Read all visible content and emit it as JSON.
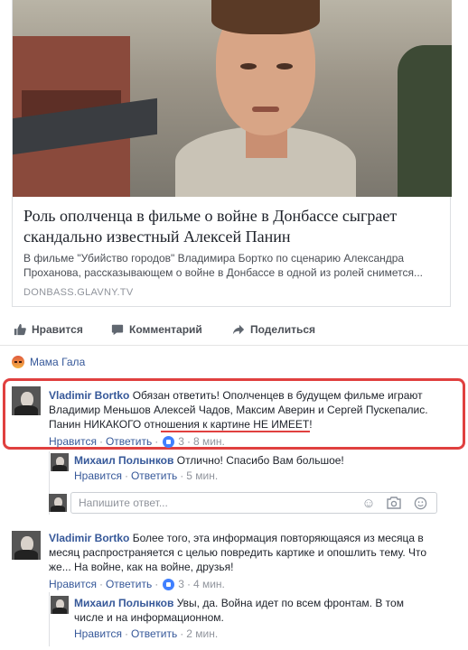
{
  "link": {
    "title": "Роль ополченца в фильме о войне в Донбассе сыграет скандально известный Алексей Панин",
    "description": "В фильме \"Убийство городов\" Владимира Бортко по сценарию Александра Проханова, рассказывающем о войне в Донбассе в одной из ролей снимется...",
    "domain": "DONBASS.GLAVNY.TV"
  },
  "actions": {
    "like": "Нравится",
    "comment": "Комментарий",
    "share": "Поделиться"
  },
  "reaction": {
    "name": "Мама Гала",
    "icon": "angry-reaction-icon"
  },
  "comments": [
    {
      "author": "Vladimir Bortko",
      "text_line1": "Обязан ответить! Ополченцев в будущем фильме играют",
      "text_line2": "Владимир Меньшов Алексей Чадов, Максим Аверин и Сергей Пускепалис.",
      "text_line3": "Панин НИКАКОГО отношения к картине НЕ ИМЕЕТ!",
      "like": "Нравится",
      "reply": "Ответить",
      "likes": "3",
      "time": "8 мин."
    },
    {
      "author": "Vladimir Bortko",
      "text_line1": "Более того, эта информация повторяющаяся из месяца в",
      "text_line2": "месяц распространяется с целью повредить картике и опошлить тему. Что",
      "text_line3": "же... На войне, как на войне, друзья!",
      "like": "Нравится",
      "reply": "Ответить",
      "likes": "3",
      "time": "4 мин."
    }
  ],
  "replies": [
    {
      "author": "Михаил Полынков",
      "text": "Отлично! Спасибо Вам большое!",
      "like": "Нравится",
      "reply": "Ответить",
      "time": "5 мин."
    },
    {
      "author": "Михаил Полынков",
      "text_line1": "Увы, да. Война идет по всем фронтам. В том",
      "text_line2": "числе и на информационном.",
      "like": "Нравится",
      "reply": "Ответить",
      "time": "2 мин."
    }
  ],
  "reply_box": {
    "placeholder": "Напишите ответ..."
  },
  "colors": {
    "link_blue": "#365899",
    "highlight_red": "#e0403f",
    "meta_gray": "#90949c"
  }
}
